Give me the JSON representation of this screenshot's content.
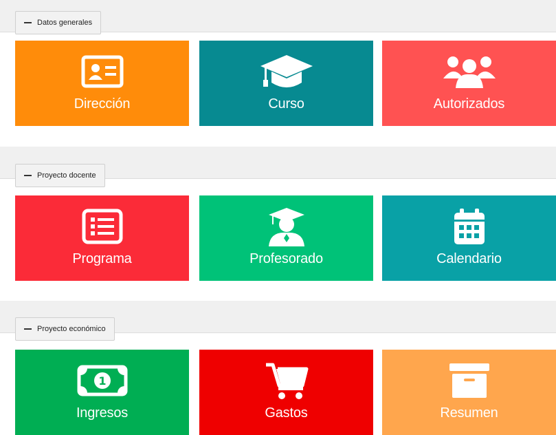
{
  "colors": {
    "section_bar": "#f0f0f0",
    "orange": "#ff8c0a",
    "teal": "#078a91",
    "coral": "#ff5252",
    "red": "#fb2b38",
    "green": "#00c278",
    "cyan": "#09a1a6",
    "ingresos_green": "#00ae53",
    "gastos_red": "#ef0000",
    "resumen_orange": "#ffa64d"
  },
  "sections": [
    {
      "toggle_label": "Datos generales",
      "tiles": [
        {
          "label": "Dirección",
          "icon": "id-card-icon"
        },
        {
          "label": "Curso",
          "icon": "graduation-cap-icon"
        },
        {
          "label": "Autorizados",
          "icon": "users-icon"
        }
      ]
    },
    {
      "toggle_label": "Proyecto docente",
      "tiles": [
        {
          "label": "Programa",
          "icon": "list-icon"
        },
        {
          "label": "Profesorado",
          "icon": "user-graduate-icon"
        },
        {
          "label": "Calendario",
          "icon": "calendar-icon"
        }
      ]
    },
    {
      "toggle_label": "Proyecto económico",
      "tiles": [
        {
          "label": "Ingresos",
          "icon": "money-bill-icon"
        },
        {
          "label": "Gastos",
          "icon": "shopping-cart-icon"
        },
        {
          "label": "Resumen",
          "icon": "archive-box-icon"
        }
      ]
    }
  ]
}
